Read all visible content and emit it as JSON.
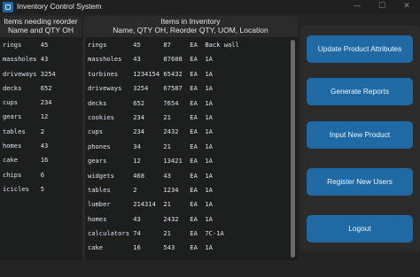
{
  "window": {
    "title": "Inventory Control System",
    "minimize": "—",
    "maximize": "☐",
    "close": "✕",
    "app_icon": "app-icon"
  },
  "reorder_panel": {
    "header_line1": "Items needing reorder",
    "header_line2": "Name and QTY OH",
    "items": [
      "rings     45",
      "massholes 43",
      "driveways 3254",
      "decks     652",
      "cups      234",
      "gears     12",
      "tables    2",
      "homes     43",
      "cake      16",
      "chips     6",
      "icicles   5"
    ]
  },
  "inventory_panel": {
    "header_line1": "Items in Inventory",
    "header_line2": "Name, QTY OH, Reorder QTY, UOM, Location",
    "items": [
      "rings       45      87     EA  Back wall",
      "massholes   43      87608  EA  1A",
      "turbines    1234154 65432  EA  1A",
      "driveways   3254    67587  EA  1A",
      "decks       652     7654   EA  1A",
      "cookies     234     21     EA  1A",
      "cups        234     2432   EA  1A",
      "phones      34      21     EA  1A",
      "gears       12      13421  EA  1A",
      "widgets     468     43     EA  1A",
      "tables      2       1234   EA  1A",
      "lumber      214314  21     EA  1A",
      "homes       43      2432   EA  1A",
      "calculators 74      21     EA  7C-1A",
      "cake        16      543    EA  1A"
    ]
  },
  "actions": {
    "update_product": "Update Product Attributes",
    "generate_reports": "Generate Reports",
    "input_product": "Input New Product",
    "register_users": "Register New Users",
    "logout": "Logout"
  },
  "colors": {
    "accent": "#1f6aa5",
    "background": "#242424",
    "panel": "#2b2b2b",
    "listbox": "#1d1e1e"
  }
}
